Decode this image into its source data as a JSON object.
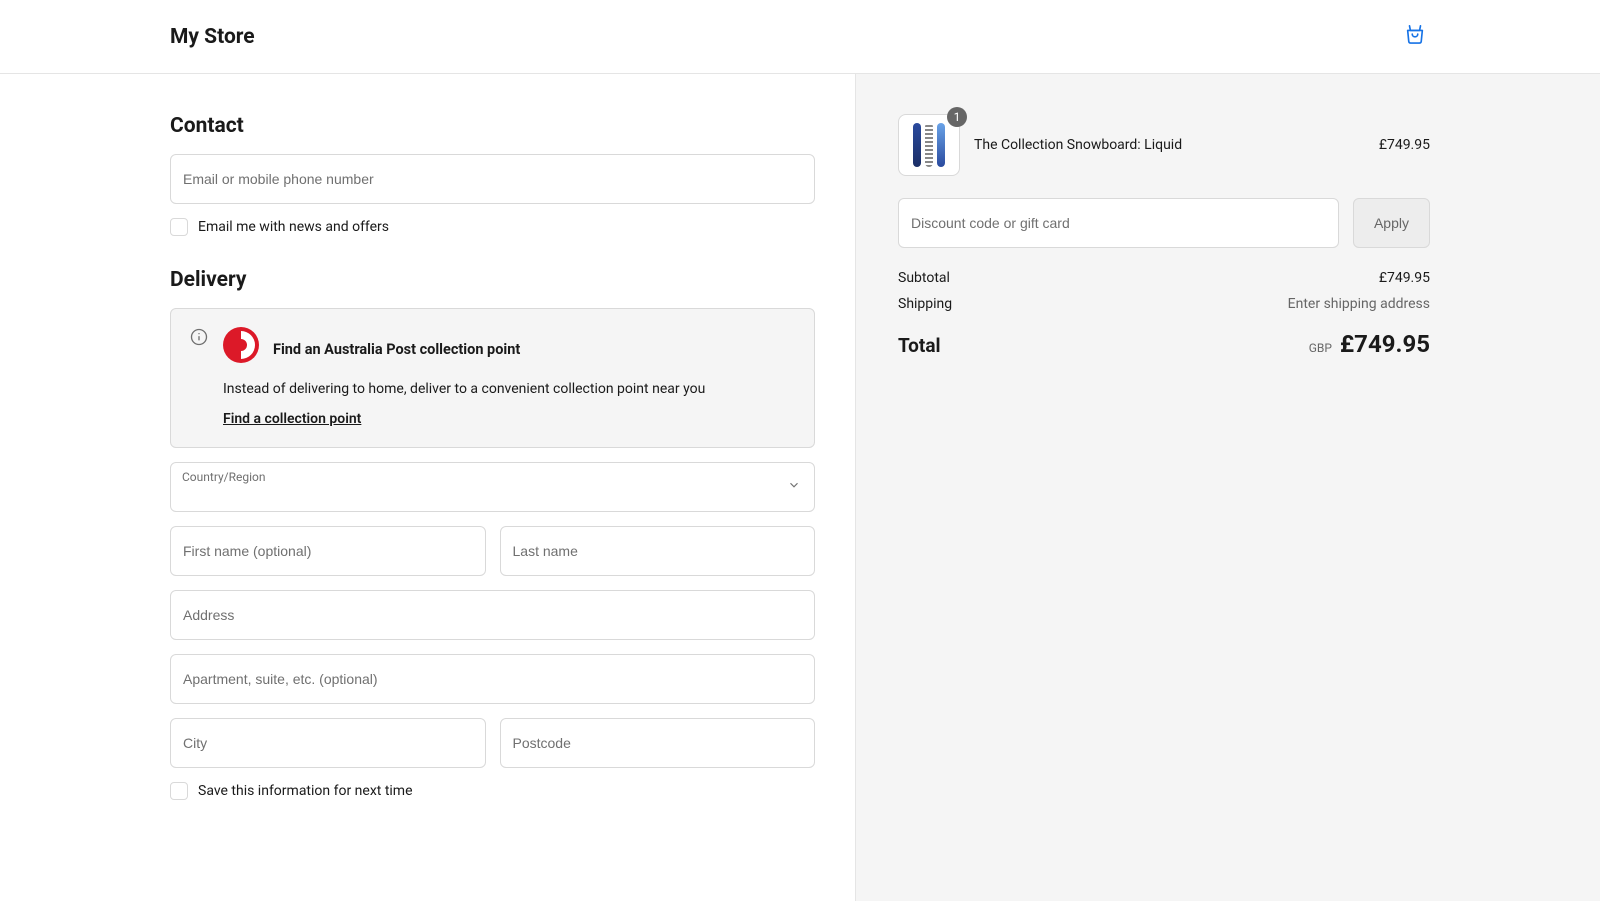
{
  "header": {
    "brand": "My Store"
  },
  "contact": {
    "title": "Contact",
    "email_placeholder": "Email or mobile phone number",
    "email_value": "",
    "news_label": "Email me with news and offers"
  },
  "delivery": {
    "title": "Delivery",
    "notice": {
      "title": "Find an Australia Post collection point",
      "desc": "Instead of delivering to home, deliver to a convenient collection point near you",
      "link": "Find a collection point"
    },
    "country_label": "Country/Region",
    "country_value": "",
    "first_name_placeholder": "First name (optional)",
    "last_name_placeholder": "Last name",
    "address_placeholder": "Address",
    "apt_placeholder": "Apartment, suite, etc. (optional)",
    "city_placeholder": "City",
    "postcode_placeholder": "Postcode",
    "save_label": "Save this information for next time"
  },
  "cart": {
    "items": [
      {
        "qty": "1",
        "title": "The Collection Snowboard: Liquid",
        "price": "£749.95"
      }
    ],
    "discount_placeholder": "Discount code or gift card",
    "apply_label": "Apply",
    "subtotal_label": "Subtotal",
    "subtotal_value": "£749.95",
    "shipping_label": "Shipping",
    "shipping_value": "Enter shipping address",
    "total_label": "Total",
    "currency": "GBP",
    "total_value": "£749.95"
  }
}
